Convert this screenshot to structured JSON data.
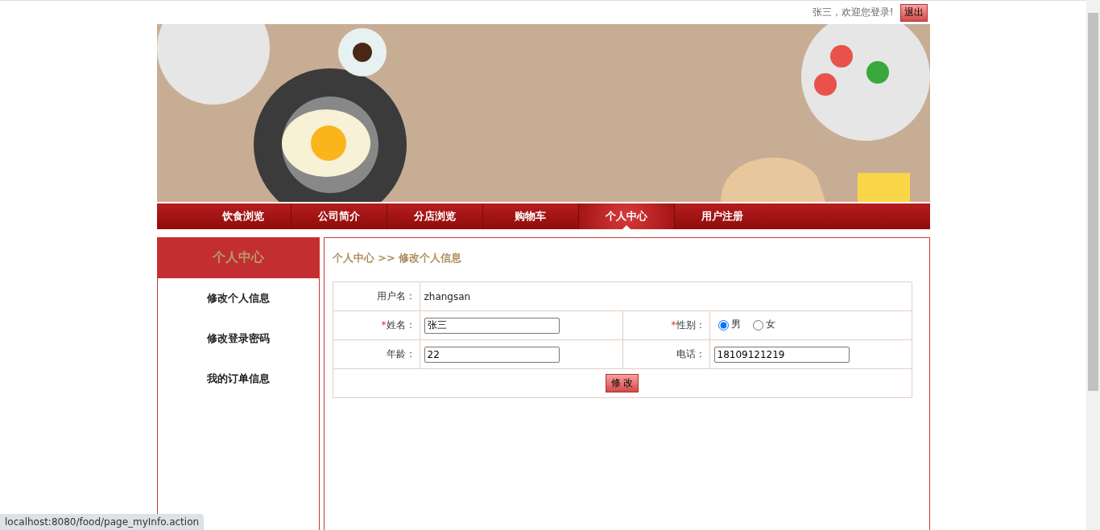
{
  "top_bar": {
    "greeting": "张三，欢迎您登录!",
    "logout": "退出"
  },
  "nav": [
    {
      "label": "饮食浏览",
      "selected": false
    },
    {
      "label": "公司简介",
      "selected": false
    },
    {
      "label": "分店浏览",
      "selected": false
    },
    {
      "label": "购物车",
      "selected": false
    },
    {
      "label": "个人中心",
      "selected": true
    },
    {
      "label": "用户注册",
      "selected": false
    }
  ],
  "sidebar": {
    "title": "个人中心",
    "items": [
      "修改个人信息",
      "修改登录密码",
      "我的订单信息"
    ]
  },
  "breadcrumb": "个人中心 >> 修改个人信息",
  "form": {
    "username_label": "用户名：",
    "username": "zhangsan",
    "name_label": "姓名：",
    "name": "张三",
    "gender_label": "性别：",
    "genders": [
      {
        "label": "男",
        "selected": true
      },
      {
        "label": "女",
        "selected": false
      }
    ],
    "age_label": "年龄：",
    "age": "22",
    "phone_label": "电话：",
    "phone": "18109121219",
    "required_mark": "*",
    "submit": "修 改"
  },
  "status_bar": "localhost:8080/food/page_myInfo.action"
}
